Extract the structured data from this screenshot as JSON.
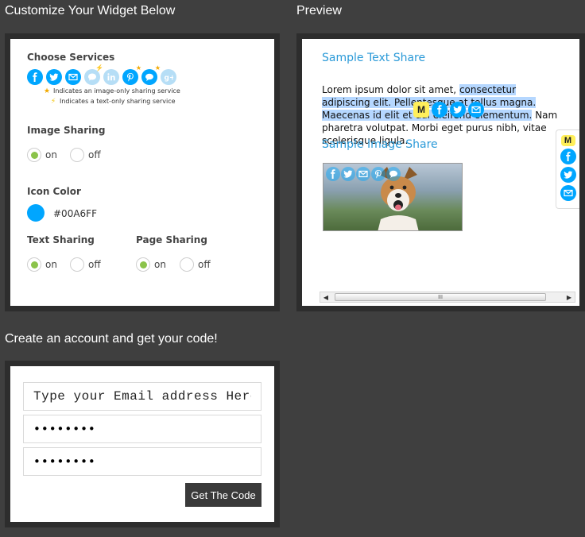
{
  "customize": {
    "heading": "Customize Your Widget Below",
    "services_label": "Choose Services",
    "services": [
      {
        "icon": "facebook-icon",
        "active": true,
        "badge": ""
      },
      {
        "icon": "twitter-icon",
        "active": true,
        "badge": ""
      },
      {
        "icon": "email-icon",
        "active": true,
        "badge": ""
      },
      {
        "icon": "chat-bubble-icon",
        "active": false,
        "badge": "bolt"
      },
      {
        "icon": "linkedin-icon",
        "active": false,
        "badge": ""
      },
      {
        "icon": "pinterest-icon",
        "active": true,
        "badge": "star"
      },
      {
        "icon": "comment-icon",
        "active": true,
        "badge": "star"
      },
      {
        "icon": "google-plus-icon",
        "active": false,
        "badge": ""
      }
    ],
    "legend_image_only": "Indicates an image-only sharing service",
    "legend_text_only": "Indicates a text-only sharing service",
    "image_sharing_label": "Image Sharing",
    "image_sharing": {
      "on_label": "on",
      "off_label": "off",
      "selected": "on"
    },
    "icon_color_label": "Icon Color",
    "icon_color": "#00A6FF",
    "text_sharing_label": "Text Sharing",
    "text_sharing": {
      "on_label": "on",
      "off_label": "off",
      "selected": "on"
    },
    "page_sharing_label": "Page Sharing",
    "page_sharing": {
      "on_label": "on",
      "off_label": "off",
      "selected": "on"
    }
  },
  "preview": {
    "heading": "Preview",
    "text_title": "Sample Text Share",
    "lorem_1": "Lorem ipsum dolor sit amet, ",
    "lorem_hl": "consectetur adipiscing elit. Pellentesque at tellus magna. Maecenas id elit et dui eleifend elementum.",
    "lorem_2": " Nam pharetra volutpat. Morbi eget purus nibh, vitae scelerisque ligula.",
    "m_badge": "M",
    "image_title": "Sample Image Share",
    "scroll_grip": "III"
  },
  "account": {
    "heading": "Create an account and get your code!",
    "email_placeholder": "Type your Email address Here!",
    "password_value": "••••••••",
    "confirm_value": "••••••••",
    "submit_label": "Get The Code"
  }
}
